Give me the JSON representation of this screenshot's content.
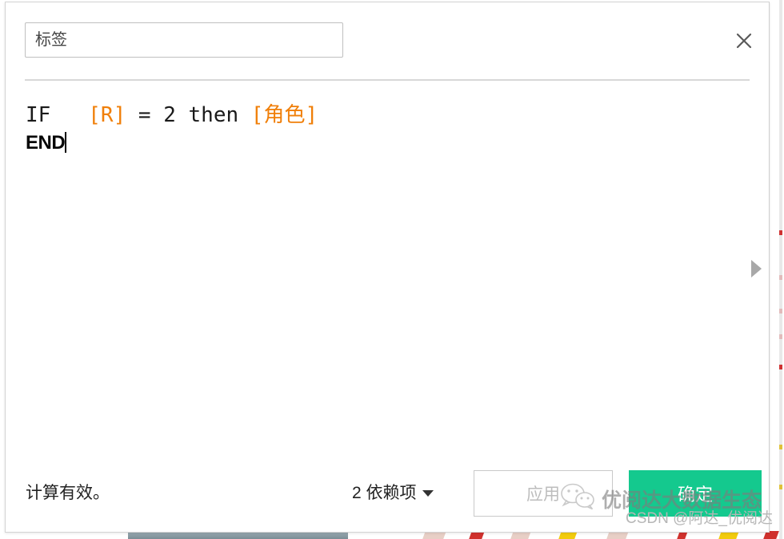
{
  "dialog": {
    "label_input": {
      "value": "",
      "placeholder": "标签",
      "name": "label"
    },
    "close_icon": "close-icon",
    "expand_icon": "play-triangle-icon"
  },
  "formula": {
    "line1_keyword": "IF",
    "line1_gap": "   ",
    "line1_field1": "[R]",
    "line1_operator": " = 2 then ",
    "line1_field2": "[角色]",
    "line2": "END",
    "full_text": "IF   [R] = 2 then [角色]\nEND",
    "field_color": "#f07f09",
    "plain_color": "#1a1a1a"
  },
  "footer": {
    "status_text": "计算有效。",
    "dependencies_label": "2 依赖项",
    "dependencies_caret": "chevron-down-icon",
    "apply_label": "应用",
    "apply_enabled": false,
    "ok_label": "确定",
    "ok_color": "#14c98e"
  },
  "watermarks": {
    "brand_text": "优阅达大数据生态",
    "wechat_icon": "wechat-icon",
    "csdn_text": "CSDN @阿达_优阅达"
  }
}
